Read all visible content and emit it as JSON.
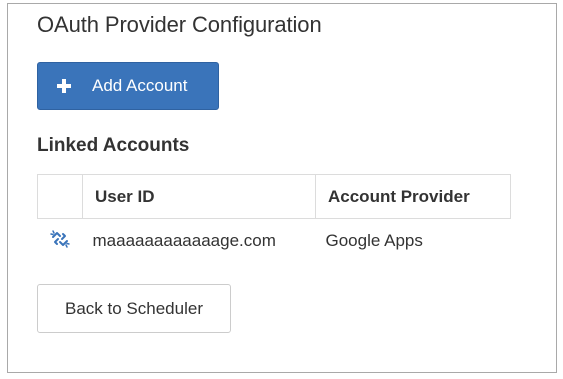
{
  "header": {
    "title": "OAuth Provider Configuration"
  },
  "toolbar": {
    "add_account_label": "Add Account",
    "add_account_icon": "plus-icon"
  },
  "linked_accounts": {
    "title": "Linked Accounts",
    "columns": [
      "",
      "User ID",
      "Account Provider"
    ],
    "rows": [
      {
        "icon": "unlink-icon",
        "user_id": "maaaaaaaaaaaage.com",
        "provider": "Google Apps"
      }
    ]
  },
  "footer": {
    "back_label": "Back to Scheduler"
  },
  "colors": {
    "primary_button": "#3a74ba",
    "unlink_icon": "#3a74ba",
    "border": "#a9a9a9"
  }
}
